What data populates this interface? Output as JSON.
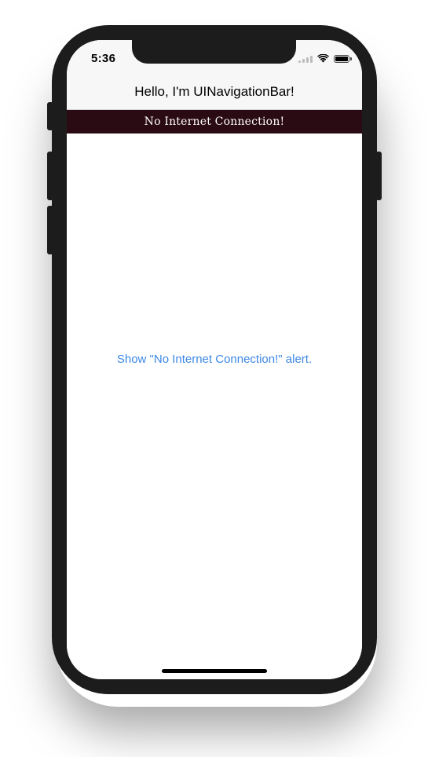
{
  "status_bar": {
    "time": "5:36",
    "signal_icon": "cellular-signal-icon",
    "wifi_icon": "wifi-icon",
    "battery_icon": "battery-icon"
  },
  "navigation_bar": {
    "title": "Hello, I'm UINavigationBar!"
  },
  "banner": {
    "text": "No Internet Connection!",
    "background_color": "#2a0a13",
    "text_color": "#ffffff"
  },
  "main": {
    "show_alert_label": "Show \"No Internet Connection!\" alert.",
    "link_color": "#3d88e6"
  }
}
